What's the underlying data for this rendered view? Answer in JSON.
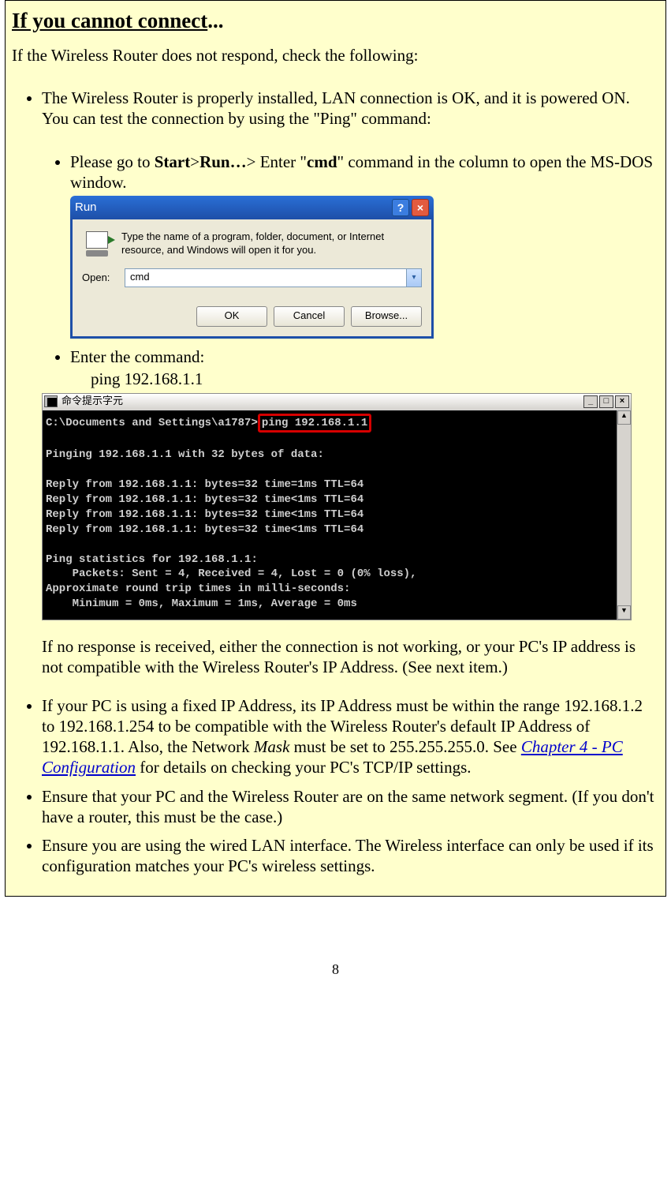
{
  "heading": {
    "underlined": "If you cannot connect",
    "suffix": "..."
  },
  "intro": "If the Wireless  Router does not respond, check the following:",
  "bullet1": "The Wireless  Router is properly installed, LAN connection is OK, and it is powered ON. You can test the connection by using the \"Ping\" command:",
  "sub1": {
    "prefix": "Please go to ",
    "start": "Start",
    "gt1": ">",
    "run": "Run…",
    "gt2": "> Enter \"",
    "cmd": "cmd",
    "suffix": "\" command in the column to open the MS-DOS window."
  },
  "run_dialog": {
    "title": "Run",
    "help_btn": "?",
    "close_btn": "×",
    "description": "Type the name of a program, folder, document, or Internet resource, and Windows will open it for you.",
    "open_label": "Open:",
    "input_value": "cmd",
    "ok": "OK",
    "cancel": "Cancel",
    "browse": "Browse..."
  },
  "sub2": {
    "label": "Enter the command:",
    "command": "ping 192.168.1.1"
  },
  "cmd_window": {
    "title": "命令提示字元",
    "min": "_",
    "max": "□",
    "close": "×",
    "scroll_up": "▲",
    "scroll_down": "▼",
    "prompt": "C:\\Documents and Settings\\a1787>",
    "typed": "ping 192.168.1.1",
    "lines": [
      "",
      "Pinging 192.168.1.1 with 32 bytes of data:",
      "",
      "Reply from 192.168.1.1: bytes=32 time=1ms TTL=64",
      "Reply from 192.168.1.1: bytes=32 time<1ms TTL=64",
      "Reply from 192.168.1.1: bytes=32 time<1ms TTL=64",
      "Reply from 192.168.1.1: bytes=32 time<1ms TTL=64",
      "",
      "Ping statistics for 192.168.1.1:",
      "    Packets: Sent = 4, Received = 4, Lost = 0 (0% loss),",
      "Approximate round trip times in milli-seconds:",
      "    Minimum = 0ms, Maximum = 1ms, Average = 0ms"
    ]
  },
  "post_cmd": "If no response is received, either the connection is not working, or your PC's IP address is not compatible with the Wireless  Router's IP Address. (See next item.)",
  "bullet2": {
    "p1": "If your PC is using a fixed IP Address, its IP Address must be within the range 192.168.1.2 to 192.168.1.254 to be compatible with the Wireless  Router's default IP Address of 192.168.1.1. Also, the Network ",
    "mask": "Mask",
    "p2": " must be set to 255.255.255.0. See ",
    "link": "Chapter 4 - PC Configuration",
    "p3": " for details on checking your PC's TCP/IP settings."
  },
  "bullet3": "Ensure that your PC and the Wireless  Router are on the same network segment. (If you don't have a router, this must be the case.)",
  "bullet4": "Ensure you are using the wired LAN interface. The Wireless interface can only be used if its configuration matches your PC's wireless settings.",
  "page_number": "8"
}
